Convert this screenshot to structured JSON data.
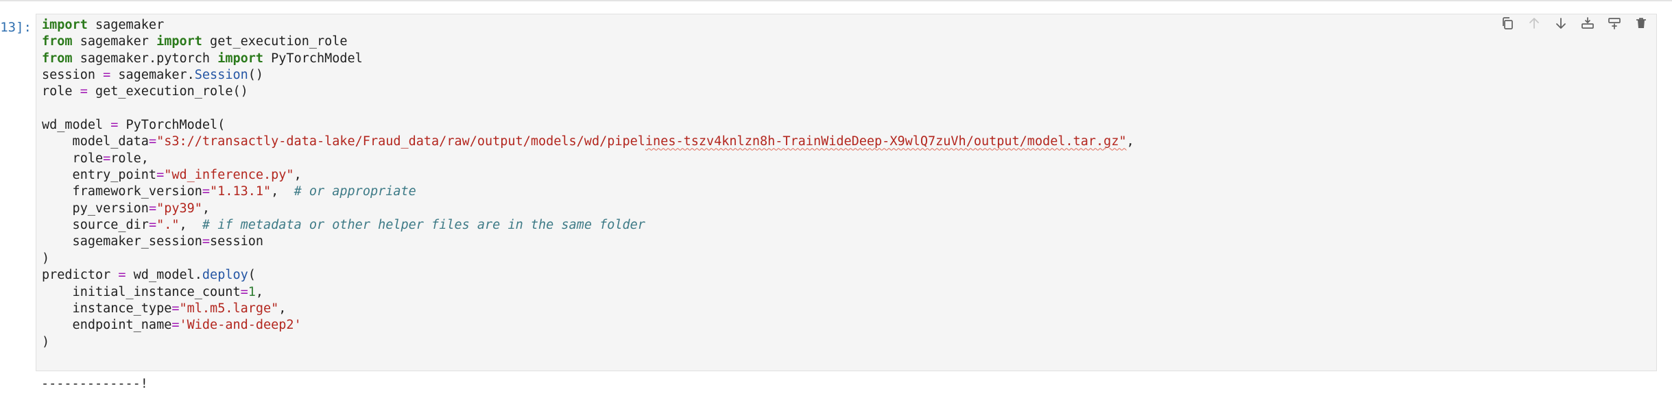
{
  "cell": {
    "prompt": "13]:",
    "code_lines": [
      [
        {
          "t": "import",
          "c": "kw"
        },
        {
          "t": " sagemaker"
        }
      ],
      [
        {
          "t": "from",
          "c": "kw"
        },
        {
          "t": " sagemaker "
        },
        {
          "t": "import",
          "c": "kw"
        },
        {
          "t": " get_execution_role"
        }
      ],
      [
        {
          "t": "from",
          "c": "kw"
        },
        {
          "t": " sagemaker.pytorch "
        },
        {
          "t": "import",
          "c": "kw"
        },
        {
          "t": " PyTorchModel"
        }
      ],
      [
        {
          "t": "session "
        },
        {
          "t": "=",
          "c": "op"
        },
        {
          "t": " sagemaker."
        },
        {
          "t": "Session",
          "c": "attr"
        },
        {
          "t": "()"
        }
      ],
      [
        {
          "t": "role "
        },
        {
          "t": "=",
          "c": "op"
        },
        {
          "t": " get_execution_role()"
        }
      ],
      [],
      [
        {
          "t": "wd_model "
        },
        {
          "t": "=",
          "c": "op"
        },
        {
          "t": " PyTorchModel("
        }
      ],
      [
        {
          "t": "    model_data"
        },
        {
          "t": "=",
          "c": "op"
        },
        {
          "t": "\"s3://transactly-data-lake/Fraud_data/raw/output/models/wd/pipel",
          "c": "str"
        },
        {
          "t": "ines-tszv4knlzn8h-TrainWideDeep-X9wlQ7zuVh/output/model.tar.gz\"",
          "c": "str spell"
        },
        {
          "t": ","
        }
      ],
      [
        {
          "t": "    role"
        },
        {
          "t": "=",
          "c": "op"
        },
        {
          "t": "role,"
        }
      ],
      [
        {
          "t": "    entry_point"
        },
        {
          "t": "=",
          "c": "op"
        },
        {
          "t": "\"wd_inference.py\"",
          "c": "str"
        },
        {
          "t": ","
        }
      ],
      [
        {
          "t": "    framework_version"
        },
        {
          "t": "=",
          "c": "op"
        },
        {
          "t": "\"1.13.1\"",
          "c": "str"
        },
        {
          "t": ",  "
        },
        {
          "t": "# or appropriate",
          "c": "cmt"
        }
      ],
      [
        {
          "t": "    py_version"
        },
        {
          "t": "=",
          "c": "op"
        },
        {
          "t": "\"py39\"",
          "c": "str"
        },
        {
          "t": ","
        }
      ],
      [
        {
          "t": "    source_dir"
        },
        {
          "t": "=",
          "c": "op"
        },
        {
          "t": "\".\"",
          "c": "str"
        },
        {
          "t": ",  "
        },
        {
          "t": "# if metadata or other helper files are in the same folder",
          "c": "cmt"
        }
      ],
      [
        {
          "t": "    sagemaker_session"
        },
        {
          "t": "=",
          "c": "op"
        },
        {
          "t": "session"
        }
      ],
      [
        {
          "t": ")"
        }
      ],
      [
        {
          "t": "predictor "
        },
        {
          "t": "=",
          "c": "op"
        },
        {
          "t": " wd_model."
        },
        {
          "t": "deploy",
          "c": "attr"
        },
        {
          "t": "("
        }
      ],
      [
        {
          "t": "    initial_instance_count"
        },
        {
          "t": "=",
          "c": "op"
        },
        {
          "t": "1",
          "c": "num"
        },
        {
          "t": ","
        }
      ],
      [
        {
          "t": "    instance_type"
        },
        {
          "t": "=",
          "c": "op"
        },
        {
          "t": "\"ml.m5.large\"",
          "c": "str"
        },
        {
          "t": ","
        }
      ],
      [
        {
          "t": "    endpoint_name"
        },
        {
          "t": "=",
          "c": "op"
        },
        {
          "t": "'Wide-and-deep2'",
          "c": "str"
        }
      ],
      [
        {
          "t": ")"
        }
      ]
    ],
    "output": "-------------!"
  },
  "toolbar": [
    {
      "name": "duplicate-cell-button",
      "icon": "copy-icon",
      "state": "enabled"
    },
    {
      "name": "move-up-button",
      "icon": "arrow-up-icon",
      "state": "disabled"
    },
    {
      "name": "move-down-button",
      "icon": "arrow-down-icon",
      "state": "enabled"
    },
    {
      "name": "insert-above-button",
      "icon": "insert-above-icon",
      "state": "enabled"
    },
    {
      "name": "insert-below-button",
      "icon": "insert-below-icon",
      "state": "enabled"
    },
    {
      "name": "delete-cell-button",
      "icon": "trash-icon",
      "state": "enabled"
    }
  ],
  "colors": {
    "cell_background": "#f5f5f5",
    "keyword": "#2b7a1b",
    "operator": "#a21ab5",
    "attribute": "#2455a4",
    "string": "#b3261e",
    "comment": "#3d7a86",
    "prompt": "#2f6fb0"
  }
}
